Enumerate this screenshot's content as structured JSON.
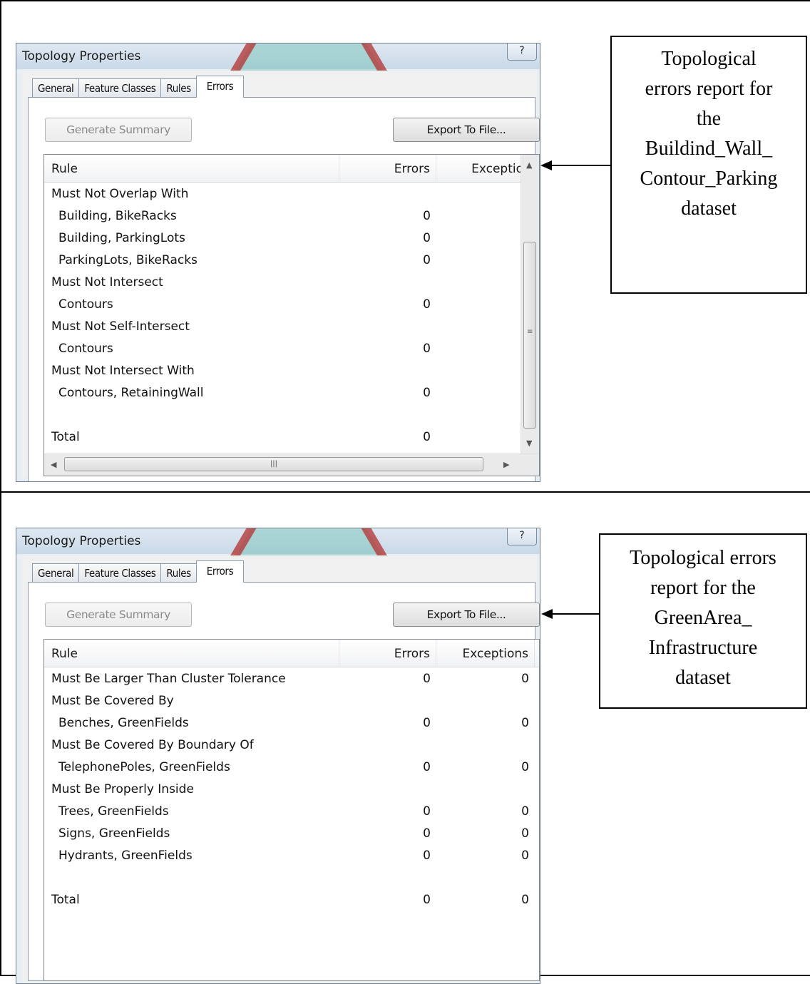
{
  "panels": [
    {
      "dialog_title": "Topology Properties",
      "help_label": "?",
      "tabs": [
        "General",
        "Feature Classes",
        "Rules",
        "Errors"
      ],
      "active_tab": "Errors",
      "generate_label": "Generate Summary",
      "export_label": "Export To File...",
      "columns": {
        "rule": "Rule",
        "errors": "Errors",
        "exceptions": "Exceptior"
      },
      "rows": [
        {
          "rule": "Must Not Overlap With",
          "errors": "",
          "exceptions": ""
        },
        {
          "rule": "Building, BikeRacks",
          "errors": "0",
          "exceptions": ""
        },
        {
          "rule": "Building, ParkingLots",
          "errors": "0",
          "exceptions": ""
        },
        {
          "rule": "ParkingLots, BikeRacks",
          "errors": "0",
          "exceptions": ""
        },
        {
          "rule": "Must Not Intersect",
          "errors": "",
          "exceptions": ""
        },
        {
          "rule": "Contours",
          "errors": "0",
          "exceptions": ""
        },
        {
          "rule": "Must Not Self-Intersect",
          "errors": "",
          "exceptions": ""
        },
        {
          "rule": "Contours",
          "errors": "0",
          "exceptions": ""
        },
        {
          "rule": "Must Not Intersect With",
          "errors": "",
          "exceptions": ""
        },
        {
          "rule": "Contours, RetainingWall",
          "errors": "0",
          "exceptions": ""
        },
        {
          "rule": "",
          "errors": "",
          "exceptions": ""
        },
        {
          "rule": "Total",
          "errors": "0",
          "exceptions": ""
        }
      ],
      "callout_lines": [
        "Topological",
        "errors report for",
        "the",
        "Buildind_Wall_",
        "Contour_Parking",
        "dataset"
      ]
    },
    {
      "dialog_title": "Topology Properties",
      "help_label": "?",
      "tabs": [
        "General",
        "Feature Classes",
        "Rules",
        "Errors"
      ],
      "active_tab": "Errors",
      "generate_label": "Generate Summary",
      "export_label": "Export To File...",
      "columns": {
        "rule": "Rule",
        "errors": "Errors",
        "exceptions": "Exceptions"
      },
      "rows": [
        {
          "rule": "Must Be Larger Than Cluster Tolerance",
          "errors": "0",
          "exceptions": "0"
        },
        {
          "rule": "Must Be Covered By",
          "errors": "",
          "exceptions": ""
        },
        {
          "rule": "Benches, GreenFields",
          "errors": "0",
          "exceptions": "0"
        },
        {
          "rule": "Must Be Covered By Boundary Of",
          "errors": "",
          "exceptions": ""
        },
        {
          "rule": "TelephonePoles, GreenFields",
          "errors": "0",
          "exceptions": "0"
        },
        {
          "rule": "Must Be Properly Inside",
          "errors": "",
          "exceptions": ""
        },
        {
          "rule": "Trees, GreenFields",
          "errors": "0",
          "exceptions": "0"
        },
        {
          "rule": "Signs, GreenFields",
          "errors": "0",
          "exceptions": "0"
        },
        {
          "rule": "Hydrants, GreenFields",
          "errors": "0",
          "exceptions": "0"
        },
        {
          "rule": "",
          "errors": "",
          "exceptions": ""
        },
        {
          "rule": "Total",
          "errors": "0",
          "exceptions": "0"
        }
      ],
      "callout_lines": [
        "Topological errors",
        "report for the",
        "GreenArea_",
        "Infrastructure",
        "dataset"
      ]
    }
  ],
  "icons": {
    "help": "question-mark-icon",
    "scroll_up": "arrow-up-icon",
    "scroll_down": "arrow-down-icon",
    "scroll_left": "arrow-left-icon",
    "scroll_right": "arrow-right-icon",
    "scroll_grip": "grip-icon"
  },
  "colors": {
    "dialog_frame": "#6f8093",
    "titlebar": "#c9d9e8",
    "decor_red": "#b43b3b",
    "decor_teal": "#7fc7bd"
  }
}
